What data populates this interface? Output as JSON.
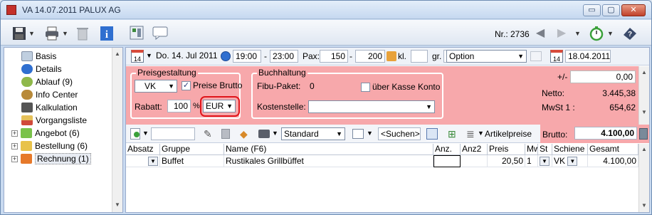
{
  "window": {
    "title": "VA 14.07.2011 PALUX AG",
    "min_glyph": "▭",
    "max_glyph": "▢",
    "close_glyph": "✕"
  },
  "toolbar": {
    "nr_label": "Nr.: 2736",
    "icons": [
      "save-icon",
      "print-icon",
      "trash-icon",
      "info-icon",
      "calculator-icon",
      "comment-icon",
      "back-arrow-icon",
      "forward-arrow-icon",
      "stopwatch-icon",
      "help-icon"
    ]
  },
  "sidebar": {
    "items": [
      {
        "label": "Basis",
        "icon": "form-icon",
        "color": "#c0cfe0"
      },
      {
        "label": "Details",
        "icon": "info-icon",
        "color": "#2f6fd0"
      },
      {
        "label": "Ablauf (9)",
        "icon": "clock-icon",
        "color": "#8fb84a"
      },
      {
        "label": "Info Center",
        "icon": "gear-icon",
        "color": "#b88a3a"
      },
      {
        "label": "Kalkulation",
        "icon": "calculator-icon",
        "color": "#555555"
      },
      {
        "label": "Vorgangsliste",
        "icon": "list-icon",
        "color": "#e6c15a"
      },
      {
        "label": "Angebot (6)",
        "icon": "folder-icon",
        "color": "#7ac24a",
        "expandable": true
      },
      {
        "label": "Bestellung (6)",
        "icon": "folder-icon",
        "color": "#e8c24a",
        "expandable": true
      },
      {
        "label": "Rechnung (1)",
        "icon": "puzzle-icon",
        "color": "#e6792a",
        "expandable": true,
        "selected": true
      }
    ]
  },
  "event": {
    "calendar_day": "14",
    "date": "Do. 14. Jul 2011",
    "time_from": "19:00",
    "time_sep": "-",
    "time_to": "23:00",
    "pax_label": "Pax:",
    "pax_from": "150",
    "pax_sep": "-",
    "pax_to": "200",
    "kl_label": "kl.",
    "kl_value": "",
    "gr_label": "gr.",
    "gr_value": "",
    "option": "Option",
    "option_date": "18.04.2011"
  },
  "pricing": {
    "group_title": "Preisgestaltung",
    "price_type": "VK",
    "brutto_checkbox_label": "Preise Brutto",
    "brutto_checked": true,
    "rabatt_label": "Rabatt:",
    "rabatt_value": "100",
    "percent": "%",
    "currency": "EUR"
  },
  "accounting": {
    "group_title": "Buchhaltung",
    "fibu_label": "Fibu-Paket:",
    "fibu_value": "0",
    "kasse_label": "über Kasse Konto",
    "kasse_checked": false,
    "kostenstelle_label": "Kostenstelle:",
    "kostenstelle_value": ""
  },
  "totals": {
    "diff_label": "+/-",
    "diff_value": "0,00",
    "netto_label": "Netto:",
    "netto_value": "3.445,38",
    "mwst_label": "MwSt 1 :",
    "mwst_value": "654,62",
    "brutto_label": "Brutto:",
    "brutto_value": "4.100,00"
  },
  "grid_toolbar": {
    "view": "Standard",
    "search": "<Suchen>",
    "artikelpreise": "Artikelpreise"
  },
  "table": {
    "columns": [
      "Absatz",
      "Gruppe",
      "Name (F6)",
      "Anz.",
      "Anz2",
      "Preis",
      "Mw",
      "St",
      "Schiene",
      "Gesamt"
    ],
    "rows": [
      {
        "absatz": "",
        "gruppe": "Buffet",
        "name": "Rustikales Grillbüffet",
        "anz": "",
        "anz2": "",
        "preis": "20,50",
        "mw": "1",
        "st": "",
        "schiene": "VK",
        "gesamt": "4.100,00"
      }
    ]
  },
  "colors": {
    "accent_pink": "#f7a8ab",
    "highlight_ring": "#e0151b",
    "chrome_blue": "#c9daf0"
  }
}
